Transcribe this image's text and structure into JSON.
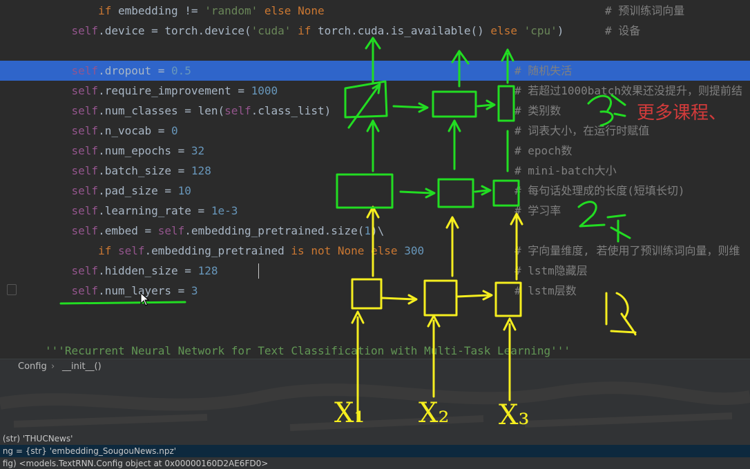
{
  "code_lines": [
    {
      "indent": "        ",
      "tokens": [
        [
          "kw",
          "if "
        ],
        [
          "plain",
          "embedding "
        ],
        [
          "plain",
          "!= "
        ],
        [
          "str",
          "'random' "
        ],
        [
          "kw",
          "else None"
        ]
      ],
      "comment": "# 预训练词向量",
      "comment_alt": true
    },
    {
      "indent": "    ",
      "tokens": [
        [
          "self",
          "self"
        ],
        [
          "plain",
          ".device = torch.device("
        ],
        [
          "str",
          "'cuda' "
        ],
        [
          "kw",
          "if "
        ],
        [
          "plain",
          "torch.cuda.is_available() "
        ],
        [
          "kw",
          "else "
        ],
        [
          "str",
          "'cpu'"
        ],
        [
          "plain",
          ")"
        ]
      ],
      "comment": "# 设备",
      "comment_alt": true
    },
    {
      "indent": "",
      "tokens": [],
      "comment": ""
    },
    {
      "indent": "    ",
      "tokens": [
        [
          "self",
          "self"
        ],
        [
          "plain",
          ".dropout = "
        ],
        [
          "num",
          "0.5"
        ]
      ],
      "comment": "# 随机失活",
      "current": true
    },
    {
      "indent": "    ",
      "tokens": [
        [
          "self",
          "self"
        ],
        [
          "plain",
          ".require_improvement = "
        ],
        [
          "num",
          "1000"
        ]
      ],
      "comment": "# 若超过1000batch效果还没提升，则提前结"
    },
    {
      "indent": "    ",
      "tokens": [
        [
          "self",
          "self"
        ],
        [
          "plain",
          ".num_classes = "
        ],
        [
          "plain",
          "len("
        ],
        [
          "self",
          "self"
        ],
        [
          "plain",
          ".class_list)"
        ]
      ],
      "comment": "# 类别数"
    },
    {
      "indent": "    ",
      "tokens": [
        [
          "self",
          "self"
        ],
        [
          "plain",
          ".n_vocab = "
        ],
        [
          "num",
          "0"
        ]
      ],
      "comment": "# 词表大小，在运行时赋值"
    },
    {
      "indent": "    ",
      "tokens": [
        [
          "self",
          "self"
        ],
        [
          "plain",
          ".num_epochs = "
        ],
        [
          "num",
          "32"
        ]
      ],
      "comment": "# epoch数"
    },
    {
      "indent": "    ",
      "tokens": [
        [
          "self",
          "self"
        ],
        [
          "plain",
          ".batch_size = "
        ],
        [
          "num",
          "128"
        ]
      ],
      "comment": "# mini-batch大小"
    },
    {
      "indent": "    ",
      "tokens": [
        [
          "self",
          "self"
        ],
        [
          "plain",
          ".pad_size = "
        ],
        [
          "num",
          "10"
        ]
      ],
      "comment": "# 每句话处理成的长度(短填长切)"
    },
    {
      "indent": "    ",
      "tokens": [
        [
          "self",
          "self"
        ],
        [
          "plain",
          ".learning_rate = "
        ],
        [
          "num",
          "1e-3"
        ]
      ],
      "comment": "# 学习率"
    },
    {
      "indent": "    ",
      "tokens": [
        [
          "self",
          "self"
        ],
        [
          "plain",
          ".embed = "
        ],
        [
          "self",
          "self"
        ],
        [
          "plain",
          ".embedding_pretrained.size("
        ],
        [
          "num",
          "1"
        ],
        [
          "plain",
          ")\\"
        ]
      ],
      "comment": ""
    },
    {
      "indent": "        ",
      "tokens": [
        [
          "kw",
          "if "
        ],
        [
          "self",
          "self"
        ],
        [
          "plain",
          ".embedding_pretrained "
        ],
        [
          "kw",
          "is not None else "
        ],
        [
          "num",
          "300"
        ]
      ],
      "comment": "# 字向量维度, 若使用了预训练词向量，则维"
    },
    {
      "indent": "    ",
      "tokens": [
        [
          "self",
          "self"
        ],
        [
          "plain",
          ".hidden_size = "
        ],
        [
          "num",
          "128"
        ]
      ],
      "comment": "# lstm隐藏层"
    },
    {
      "indent": "    ",
      "tokens": [
        [
          "self",
          "self"
        ],
        [
          "plain",
          ".num_layers = "
        ],
        [
          "num",
          "3"
        ]
      ],
      "comment": "# lstm层数"
    },
    {
      "indent": "",
      "tokens": [],
      "comment": ""
    },
    {
      "indent": "",
      "tokens": [],
      "comment": ""
    },
    {
      "indent": "",
      "tokens": [
        [
          "docstr",
          "'''Recurrent Neural Network for Text Classification with Multi-Task Learning'''"
        ]
      ],
      "comment": ""
    }
  ],
  "breadcrumb": {
    "class_name": "Config",
    "separator": "›",
    "method": "__init__()"
  },
  "debug_vars": [
    {
      "text": "(str) 'THUCNews'",
      "selected": false
    },
    {
      "text": "ng = {str} 'embedding_SougouNews.npz'",
      "selected": true
    },
    {
      "text": "fig) <models.TextRNN.Config object at 0x00000160D2AE6FD0>",
      "selected": false
    }
  ],
  "annotations": {
    "inputs": [
      "X₁",
      "X₂",
      "X₃"
    ],
    "layer_label_side": "2层",
    "layer_label_top": "3层",
    "layer_label_right": "层",
    "overlay_promo": "更多课程、",
    "colors": {
      "green": "#22dd22",
      "yellow": "#f5ee1f",
      "red": "#d33b3b"
    }
  }
}
